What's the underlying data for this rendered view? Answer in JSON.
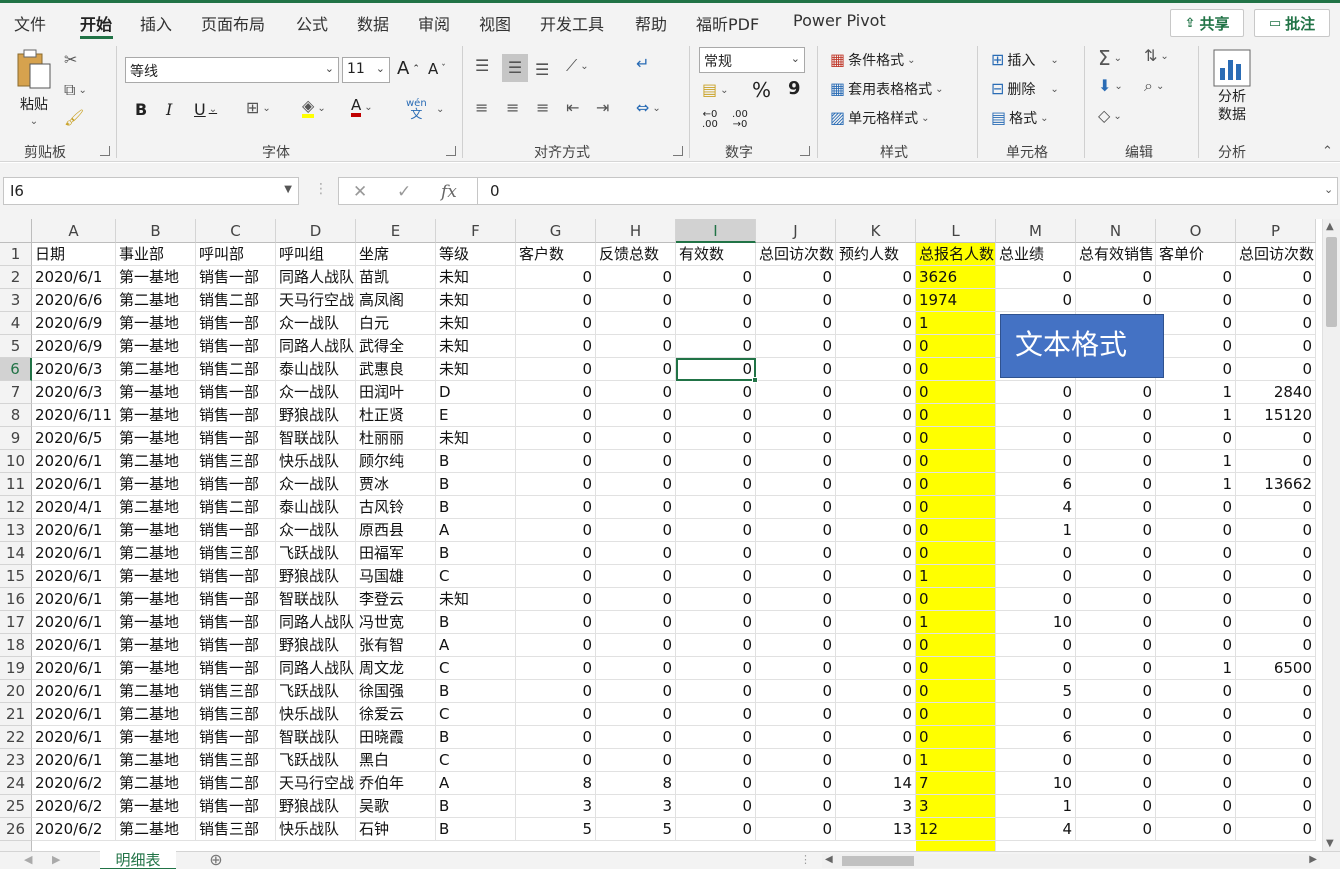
{
  "menu": {
    "tabs": [
      "文件",
      "开始",
      "插入",
      "页面布局",
      "公式",
      "数据",
      "审阅",
      "视图",
      "开发工具",
      "帮助",
      "福昕PDF",
      "Power Pivot"
    ],
    "share_label": "共享",
    "comment_label": "批注"
  },
  "ribbon": {
    "clipboard": {
      "paste": "粘贴",
      "group": "剪贴板"
    },
    "font": {
      "name": "等线",
      "size": "11",
      "grow": "A",
      "shrink": "A",
      "bold": "B",
      "italic": "I",
      "underline": "U",
      "wen": "wén",
      "wen_char": "文",
      "group": "字体"
    },
    "align": {
      "group": "对齐方式"
    },
    "number": {
      "format": "常规",
      "percent": "%",
      "comma": "9",
      "inc": ".00",
      "dec": ".00",
      "inc_top": "←0",
      "dec_top": "→0",
      "group": "数字"
    },
    "styles": {
      "conditional": "条件格式",
      "table": "套用表格格式",
      "cell": "单元格样式",
      "group": "样式"
    },
    "cells": {
      "insert": "插入",
      "delete": "删除",
      "format": "格式",
      "group": "单元格"
    },
    "editing": {
      "group": "编辑"
    },
    "analysis": {
      "label1": "分析",
      "label2": "数据",
      "group": "分析"
    }
  },
  "formula_bar": {
    "name_box": "I6",
    "value": "0",
    "fx": "fx"
  },
  "columns": [
    "A",
    "B",
    "C",
    "D",
    "E",
    "F",
    "G",
    "H",
    "I",
    "J",
    "K",
    "L",
    "M",
    "N",
    "O",
    "P"
  ],
  "headers": [
    "日期",
    "事业部",
    "呼叫部",
    "呼叫组",
    "坐席",
    "等级",
    "客户数",
    "反馈总数",
    "有效数",
    "总回访次数",
    "预约人数",
    "总报名人数",
    "总业绩",
    "总有效销售",
    "客单价",
    "总回访次数"
  ],
  "rows": [
    [
      "2020/6/1",
      "第一基地",
      "销售一部",
      "同路人战队",
      "苗凯",
      "未知",
      "0",
      "0",
      "0",
      "0",
      "0",
      "3626",
      "0",
      "0",
      "0",
      "0"
    ],
    [
      "2020/6/6",
      "第二基地",
      "销售二部",
      "天马行空战队",
      "高凤阁",
      "未知",
      "0",
      "0",
      "0",
      "0",
      "0",
      "1974",
      "0",
      "0",
      "0",
      "0"
    ],
    [
      "2020/6/9",
      "第一基地",
      "销售一部",
      "众一战队",
      "白元",
      "未知",
      "0",
      "0",
      "0",
      "0",
      "0",
      "1",
      "",
      "",
      "0",
      "0"
    ],
    [
      "2020/6/9",
      "第一基地",
      "销售一部",
      "同路人战队",
      "武得全",
      "未知",
      "0",
      "0",
      "0",
      "0",
      "0",
      "0",
      "",
      "",
      "0",
      "0"
    ],
    [
      "2020/6/3",
      "第二基地",
      "销售二部",
      "泰山战队",
      "武惠良",
      "未知",
      "0",
      "0",
      "0",
      "0",
      "0",
      "0",
      "",
      "",
      "0",
      "0"
    ],
    [
      "2020/6/3",
      "第一基地",
      "销售一部",
      "众一战队",
      "田润叶",
      "D",
      "0",
      "0",
      "0",
      "0",
      "0",
      "0",
      "0",
      "0",
      "1",
      "2840"
    ],
    [
      "2020/6/11",
      "第一基地",
      "销售一部",
      "野狼战队",
      "杜正贤",
      "E",
      "0",
      "0",
      "0",
      "0",
      "0",
      "0",
      "0",
      "0",
      "1",
      "15120"
    ],
    [
      "2020/6/5",
      "第一基地",
      "销售一部",
      "智联战队",
      "杜丽丽",
      "未知",
      "0",
      "0",
      "0",
      "0",
      "0",
      "0",
      "0",
      "0",
      "0",
      "0"
    ],
    [
      "2020/6/1",
      "第二基地",
      "销售三部",
      "快乐战队",
      "顾尔纯",
      "B",
      "0",
      "0",
      "0",
      "0",
      "0",
      "0",
      "0",
      "0",
      "1",
      "0"
    ],
    [
      "2020/6/1",
      "第一基地",
      "销售一部",
      "众一战队",
      "贾冰",
      "B",
      "0",
      "0",
      "0",
      "0",
      "0",
      "0",
      "6",
      "0",
      "1",
      "13662"
    ],
    [
      "2020/4/1",
      "第二基地",
      "销售二部",
      "泰山战队",
      "古风铃",
      "B",
      "0",
      "0",
      "0",
      "0",
      "0",
      "0",
      "4",
      "0",
      "0",
      "0"
    ],
    [
      "2020/6/1",
      "第一基地",
      "销售一部",
      "众一战队",
      "原西县",
      "A",
      "0",
      "0",
      "0",
      "0",
      "0",
      "0",
      "1",
      "0",
      "0",
      "0"
    ],
    [
      "2020/6/1",
      "第二基地",
      "销售三部",
      "飞跃战队",
      "田福军",
      "B",
      "0",
      "0",
      "0",
      "0",
      "0",
      "0",
      "0",
      "0",
      "0",
      "0"
    ],
    [
      "2020/6/1",
      "第一基地",
      "销售一部",
      "野狼战队",
      "马国雄",
      "C",
      "0",
      "0",
      "0",
      "0",
      "0",
      "1",
      "0",
      "0",
      "0",
      "0"
    ],
    [
      "2020/6/1",
      "第一基地",
      "销售一部",
      "智联战队",
      "李登云",
      "未知",
      "0",
      "0",
      "0",
      "0",
      "0",
      "0",
      "0",
      "0",
      "0",
      "0"
    ],
    [
      "2020/6/1",
      "第一基地",
      "销售一部",
      "同路人战队",
      "冯世宽",
      "B",
      "0",
      "0",
      "0",
      "0",
      "0",
      "1",
      "10",
      "0",
      "0",
      "0"
    ],
    [
      "2020/6/1",
      "第一基地",
      "销售一部",
      "野狼战队",
      "张有智",
      "A",
      "0",
      "0",
      "0",
      "0",
      "0",
      "0",
      "0",
      "0",
      "0",
      "0"
    ],
    [
      "2020/6/1",
      "第一基地",
      "销售一部",
      "同路人战队",
      "周文龙",
      "C",
      "0",
      "0",
      "0",
      "0",
      "0",
      "0",
      "0",
      "0",
      "1",
      "6500"
    ],
    [
      "2020/6/1",
      "第二基地",
      "销售三部",
      "飞跃战队",
      "徐国强",
      "B",
      "0",
      "0",
      "0",
      "0",
      "0",
      "0",
      "5",
      "0",
      "0",
      "0"
    ],
    [
      "2020/6/1",
      "第二基地",
      "销售三部",
      "快乐战队",
      "徐爱云",
      "C",
      "0",
      "0",
      "0",
      "0",
      "0",
      "0",
      "0",
      "0",
      "0",
      "0"
    ],
    [
      "2020/6/1",
      "第一基地",
      "销售一部",
      "智联战队",
      "田晓霞",
      "B",
      "0",
      "0",
      "0",
      "0",
      "0",
      "0",
      "6",
      "0",
      "0",
      "0"
    ],
    [
      "2020/6/1",
      "第二基地",
      "销售三部",
      "飞跃战队",
      "黑白",
      "C",
      "0",
      "0",
      "0",
      "0",
      "0",
      "1",
      "0",
      "0",
      "0",
      "0"
    ],
    [
      "2020/6/2",
      "第二基地",
      "销售二部",
      "天马行空战队",
      "乔伯年",
      "A",
      "8",
      "8",
      "0",
      "0",
      "14",
      "7",
      "10",
      "0",
      "0",
      "0"
    ],
    [
      "2020/6/2",
      "第一基地",
      "销售一部",
      "野狼战队",
      "吴歌",
      "B",
      "3",
      "3",
      "0",
      "0",
      "3",
      "3",
      "1",
      "0",
      "0",
      "0"
    ],
    [
      "2020/6/2",
      "第二基地",
      "销售三部",
      "快乐战队",
      "石钟",
      "B",
      "5",
      "5",
      "0",
      "0",
      "13",
      "12",
      "4",
      "0",
      "0",
      "0"
    ]
  ],
  "selected_cell": "I6",
  "textbox": "文本格式",
  "sheet_tab": "明细表",
  "colors": {
    "accent": "#217346",
    "highlight": "#ffff00",
    "textbox": "#4472c4"
  }
}
